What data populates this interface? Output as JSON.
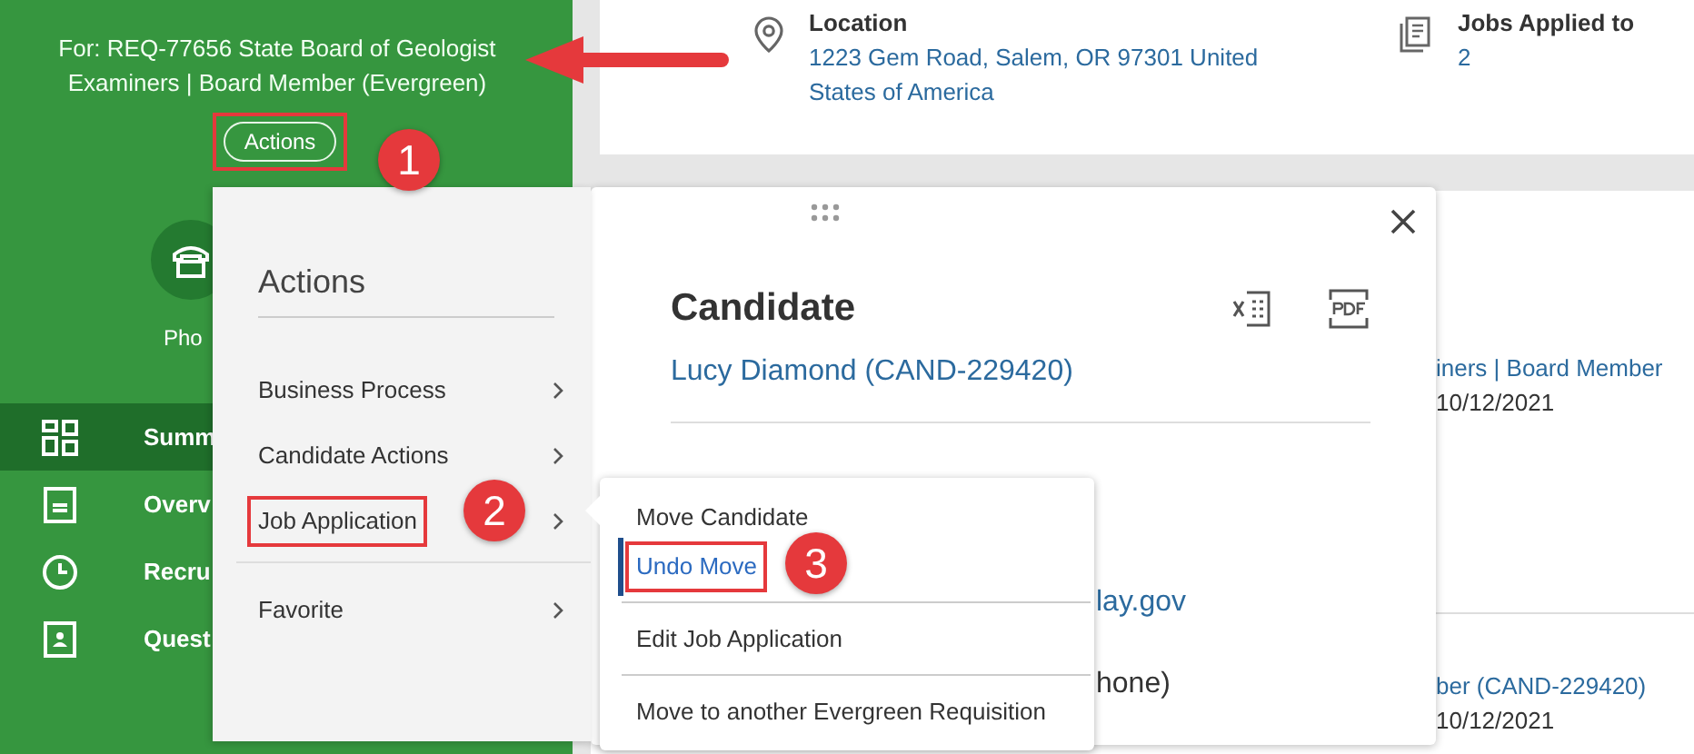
{
  "header": {
    "title_lines": [
      "For: REQ-77656 State Board of Geologist",
      "Examiners | Board Member (Evergreen)"
    ],
    "actions_button": {
      "label": "Actions",
      "marked": true
    }
  },
  "sidebar": {
    "phone_label": "Pho",
    "nav": [
      {
        "kind": "grid",
        "label": "Summ",
        "selected": true
      },
      {
        "kind": "document",
        "label": "Overv",
        "selected": false
      },
      {
        "kind": "clock",
        "label": "Recru",
        "selected": false
      },
      {
        "kind": "badge",
        "label": "Quest",
        "selected": false
      }
    ]
  },
  "info_card": {
    "location": {
      "label": "Location",
      "value": "1223 Gem Road, Salem, OR 97301 United States of America"
    },
    "jobs": {
      "label": "Jobs Applied to",
      "value": "2"
    }
  },
  "background_panel": {
    "rows": [
      {
        "title": "iners | Board Member",
        "date": "10/12/2021"
      },
      {
        "title": "ber (CAND-229420)",
        "date": "10/12/2021"
      }
    ]
  },
  "popup": {
    "title": "Candidate",
    "candidate_link": "Lucy Diamond (CAND-229420)",
    "email_fragment": "lay.gov",
    "phone_fragment": "hone)"
  },
  "actions_menu": {
    "title": "Actions",
    "items": [
      {
        "label": "Business Process",
        "marked": false,
        "divider_before": false
      },
      {
        "label": "Candidate Actions",
        "marked": false,
        "divider_before": false
      },
      {
        "label": "Job Application",
        "marked": true,
        "divider_before": false
      },
      {
        "label": "Favorite",
        "marked": false,
        "divider_before": true
      }
    ]
  },
  "submenu": {
    "items": [
      {
        "label": "Move Candidate",
        "selected": false,
        "marked": false,
        "divider_after": false
      },
      {
        "label": "Undo Move",
        "selected": true,
        "marked": true,
        "divider_after": true
      },
      {
        "label": "Edit Job Application",
        "selected": false,
        "marked": false,
        "divider_after": true
      },
      {
        "label": "Move to another Evergreen Requisition",
        "selected": false,
        "marked": false,
        "divider_after": false
      }
    ]
  },
  "callouts": [
    "1",
    "2",
    "3"
  ]
}
